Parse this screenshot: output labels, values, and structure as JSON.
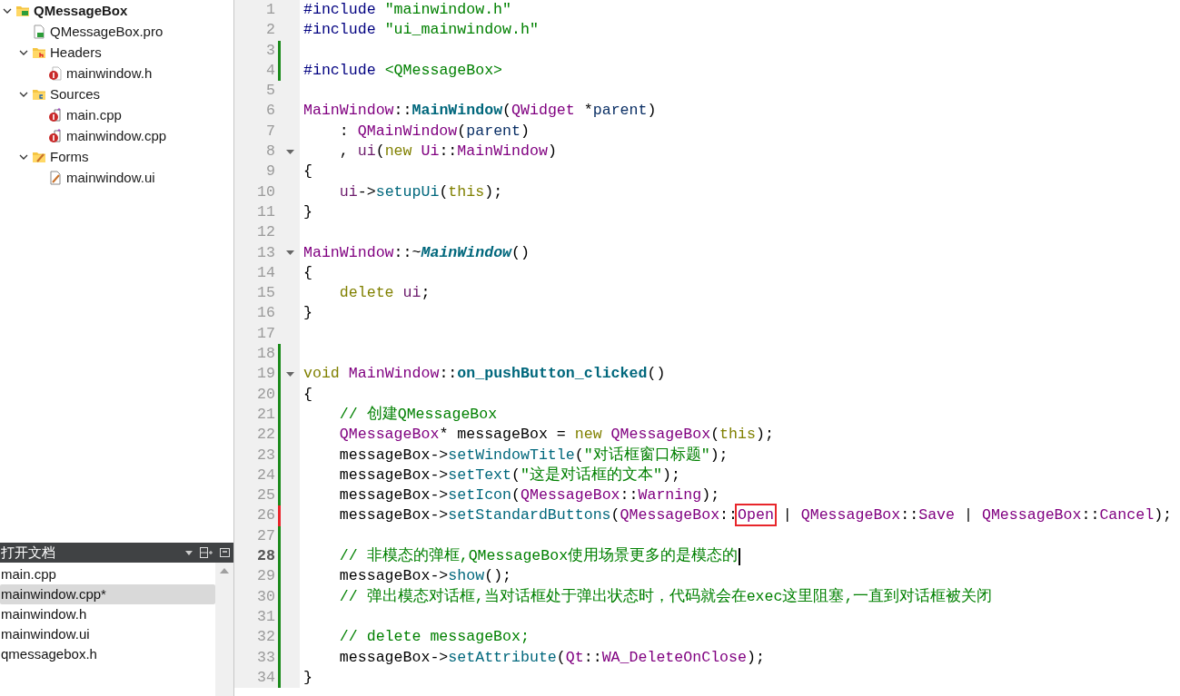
{
  "project_tree": [
    {
      "label": "QMessageBox",
      "kind": "project",
      "expanded": true,
      "children": [
        {
          "label": "QMessageBox.pro",
          "kind": "pro"
        },
        {
          "label": "Headers",
          "kind": "folder-h",
          "expanded": true,
          "children": [
            {
              "label": "mainwindow.h",
              "kind": "header"
            }
          ]
        },
        {
          "label": "Sources",
          "kind": "folder-cpp",
          "expanded": true,
          "children": [
            {
              "label": "main.cpp",
              "kind": "source"
            },
            {
              "label": "mainwindow.cpp",
              "kind": "source"
            }
          ]
        },
        {
          "label": "Forms",
          "kind": "folder-form",
          "expanded": true,
          "children": [
            {
              "label": "mainwindow.ui",
              "kind": "form"
            }
          ]
        }
      ]
    }
  ],
  "open_documents": {
    "title": "打开文档",
    "items": [
      {
        "label": "main.cpp",
        "selected": false
      },
      {
        "label": "mainwindow.cpp*",
        "selected": true
      },
      {
        "label": "mainwindow.h",
        "selected": false
      },
      {
        "label": "mainwindow.ui",
        "selected": false
      },
      {
        "label": "qmessagebox.h",
        "selected": false
      }
    ]
  },
  "editor": {
    "lines": [
      {
        "number": "1",
        "changed": false,
        "modified": false,
        "foldable": false,
        "current": false,
        "tokens": [
          {
            "text": "#include",
            "kind": "pp"
          },
          {
            "text": " \"mainwindow.h\"",
            "kind": "str"
          }
        ]
      },
      {
        "number": "2",
        "changed": false,
        "modified": false,
        "foldable": false,
        "current": false,
        "tokens": [
          {
            "text": "#include",
            "kind": "pp"
          },
          {
            "text": " \"ui_mainwindow.h\"",
            "kind": "str"
          }
        ]
      },
      {
        "number": "3",
        "changed": true,
        "modified": false,
        "foldable": false,
        "current": false
      },
      {
        "number": "4",
        "changed": true,
        "modified": false,
        "foldable": false,
        "current": false,
        "tokens": [
          {
            "text": "#include",
            "kind": "pp"
          },
          {
            "text": " <QMessageBox>",
            "kind": "str"
          }
        ]
      },
      {
        "number": "5",
        "changed": false,
        "modified": false,
        "foldable": false,
        "current": false
      },
      {
        "number": "6",
        "changed": false,
        "modified": false,
        "foldable": false,
        "current": false,
        "tokens": [
          {
            "text": "MainWindow",
            "kind": "type"
          },
          {
            "text": "::",
            "kind": "plain"
          },
          {
            "text": "MainWindow",
            "kind": "fndef"
          },
          {
            "text": "(",
            "kind": "plain"
          },
          {
            "text": "QWidget",
            "kind": "type"
          },
          {
            "text": " *",
            "kind": "plain"
          },
          {
            "text": "parent",
            "kind": "param"
          },
          {
            "text": ")",
            "kind": "plain"
          }
        ]
      },
      {
        "number": "7",
        "changed": false,
        "modified": false,
        "foldable": false,
        "current": false,
        "tokens": [
          {
            "text": "    : ",
            "kind": "plain"
          },
          {
            "text": "QMainWindow",
            "kind": "type"
          },
          {
            "text": "(",
            "kind": "plain"
          },
          {
            "text": "parent",
            "kind": "param"
          },
          {
            "text": ")",
            "kind": "plain"
          }
        ]
      },
      {
        "number": "8",
        "changed": false,
        "modified": false,
        "foldable": true,
        "current": false,
        "tokens": [
          {
            "text": "    , ",
            "kind": "plain"
          },
          {
            "text": "ui",
            "kind": "member"
          },
          {
            "text": "(",
            "kind": "plain"
          },
          {
            "text": "new",
            "kind": "kw"
          },
          {
            "text": " Ui",
            "kind": "type"
          },
          {
            "text": "::",
            "kind": "plain"
          },
          {
            "text": "MainWindow",
            "kind": "type"
          },
          {
            "text": ")",
            "kind": "plain"
          }
        ]
      },
      {
        "number": "9",
        "changed": false,
        "modified": false,
        "foldable": false,
        "current": false,
        "tokens": [
          {
            "text": "{",
            "kind": "plain"
          }
        ]
      },
      {
        "number": "10",
        "changed": false,
        "modified": false,
        "foldable": false,
        "current": false,
        "tokens": [
          {
            "text": "    ui",
            "kind": "member"
          },
          {
            "text": "->",
            "kind": "plain"
          },
          {
            "text": "setupUi",
            "kind": "fn"
          },
          {
            "text": "(",
            "kind": "plain"
          },
          {
            "text": "this",
            "kind": "kw"
          },
          {
            "text": ");",
            "kind": "plain"
          }
        ]
      },
      {
        "number": "11",
        "changed": false,
        "modified": false,
        "foldable": false,
        "current": false,
        "tokens": [
          {
            "text": "}",
            "kind": "plain"
          }
        ]
      },
      {
        "number": "12",
        "changed": false,
        "modified": false,
        "foldable": false,
        "current": false
      },
      {
        "number": "13",
        "changed": false,
        "modified": false,
        "foldable": true,
        "current": false,
        "tokens": [
          {
            "text": "MainWindow",
            "kind": "type"
          },
          {
            "text": "::~",
            "kind": "plain"
          },
          {
            "text": "MainWindow",
            "kind": "fndef_italic"
          },
          {
            "text": "()",
            "kind": "plain"
          }
        ]
      },
      {
        "number": "14",
        "changed": false,
        "modified": false,
        "foldable": false,
        "current": false,
        "tokens": [
          {
            "text": "{",
            "kind": "plain"
          }
        ]
      },
      {
        "number": "15",
        "changed": false,
        "modified": false,
        "foldable": false,
        "current": false,
        "tokens": [
          {
            "text": "    delete",
            "kind": "kw"
          },
          {
            "text": " ui",
            "kind": "member"
          },
          {
            "text": ";",
            "kind": "plain"
          }
        ]
      },
      {
        "number": "16",
        "changed": false,
        "modified": false,
        "foldable": false,
        "current": false,
        "tokens": [
          {
            "text": "}",
            "kind": "plain"
          }
        ]
      },
      {
        "number": "17",
        "changed": false,
        "modified": false,
        "foldable": false,
        "current": false
      },
      {
        "number": "18",
        "changed": true,
        "modified": false,
        "foldable": false,
        "current": false
      },
      {
        "number": "19",
        "changed": true,
        "modified": false,
        "foldable": true,
        "current": false,
        "tokens": [
          {
            "text": "void",
            "kind": "kw"
          },
          {
            "text": " MainWindow",
            "kind": "type"
          },
          {
            "text": "::",
            "kind": "plain"
          },
          {
            "text": "on_pushButton_clicked",
            "kind": "fndef"
          },
          {
            "text": "()",
            "kind": "plain"
          }
        ]
      },
      {
        "number": "20",
        "changed": true,
        "modified": false,
        "foldable": false,
        "current": false,
        "tokens": [
          {
            "text": "{",
            "kind": "plain"
          }
        ]
      },
      {
        "number": "21",
        "changed": true,
        "modified": false,
        "foldable": false,
        "current": false,
        "tokens": [
          {
            "text": "    // 创建QMessageBox",
            "kind": "cmt"
          }
        ]
      },
      {
        "number": "22",
        "changed": true,
        "modified": false,
        "foldable": false,
        "current": false,
        "tokens": [
          {
            "text": "    QMessageBox",
            "kind": "type"
          },
          {
            "text": "* messageBox = ",
            "kind": "plain"
          },
          {
            "text": "new",
            "kind": "kw"
          },
          {
            "text": " QMessageBox",
            "kind": "type"
          },
          {
            "text": "(",
            "kind": "plain"
          },
          {
            "text": "this",
            "kind": "kw"
          },
          {
            "text": ");",
            "kind": "plain"
          }
        ]
      },
      {
        "number": "23",
        "changed": true,
        "modified": false,
        "foldable": false,
        "current": false,
        "tokens": [
          {
            "text": "    messageBox->",
            "kind": "plain"
          },
          {
            "text": "setWindowTitle",
            "kind": "fn"
          },
          {
            "text": "(",
            "kind": "plain"
          },
          {
            "text": "\"对话框窗口标题\"",
            "kind": "str"
          },
          {
            "text": ");",
            "kind": "plain"
          }
        ]
      },
      {
        "number": "24",
        "changed": true,
        "modified": false,
        "foldable": false,
        "current": false,
        "tokens": [
          {
            "text": "    messageBox->",
            "kind": "plain"
          },
          {
            "text": "setText",
            "kind": "fn"
          },
          {
            "text": "(",
            "kind": "plain"
          },
          {
            "text": "\"这是对话框的文本\"",
            "kind": "str"
          },
          {
            "text": ");",
            "kind": "plain"
          }
        ]
      },
      {
        "number": "25",
        "changed": true,
        "modified": false,
        "foldable": false,
        "current": false,
        "tokens": [
          {
            "text": "    messageBox->",
            "kind": "plain"
          },
          {
            "text": "setIcon",
            "kind": "fn"
          },
          {
            "text": "(",
            "kind": "plain"
          },
          {
            "text": "QMessageBox",
            "kind": "type"
          },
          {
            "text": "::",
            "kind": "plain"
          },
          {
            "text": "Warning",
            "kind": "enum"
          },
          {
            "text": ");",
            "kind": "plain"
          }
        ]
      },
      {
        "number": "26",
        "changed": true,
        "modified": true,
        "foldable": false,
        "current": false,
        "tokens": [
          {
            "text": "    messageBox->",
            "kind": "plain"
          },
          {
            "text": "setStandardButtons",
            "kind": "fn"
          },
          {
            "text": "(",
            "kind": "plain"
          },
          {
            "text": "QMessageBox",
            "kind": "type"
          },
          {
            "text": "::",
            "kind": "plain"
          },
          {
            "text": "Open",
            "kind": "boxed"
          },
          {
            "text": " | ",
            "kind": "plain"
          },
          {
            "text": "QMessageBox",
            "kind": "type"
          },
          {
            "text": "::",
            "kind": "plain"
          },
          {
            "text": "Save",
            "kind": "enum"
          },
          {
            "text": " | ",
            "kind": "plain"
          },
          {
            "text": "QMessageBox",
            "kind": "type"
          },
          {
            "text": "::",
            "kind": "plain"
          },
          {
            "text": "Cancel",
            "kind": "enum"
          },
          {
            "text": ");",
            "kind": "plain"
          }
        ]
      },
      {
        "number": "27",
        "changed": true,
        "modified": false,
        "foldable": false,
        "current": false
      },
      {
        "number": "28",
        "changed": true,
        "modified": false,
        "foldable": false,
        "current": true,
        "tokens": [
          {
            "text": "    // 非模态的弹框,QMessageBox使用场景更多的是模态的",
            "kind": "cmt"
          }
        ]
      },
      {
        "number": "29",
        "changed": true,
        "modified": false,
        "foldable": false,
        "current": false,
        "tokens": [
          {
            "text": "    messageBox->",
            "kind": "plain"
          },
          {
            "text": "show",
            "kind": "fn"
          },
          {
            "text": "();",
            "kind": "plain"
          }
        ]
      },
      {
        "number": "30",
        "changed": true,
        "modified": false,
        "foldable": false,
        "current": false,
        "tokens": [
          {
            "text": "    // 弹出模态对话框,当对话框处于弹出状态时，代码就会在exec这里阻塞,一直到对话框被关闭",
            "kind": "cmt"
          }
        ]
      },
      {
        "number": "31",
        "changed": true,
        "modified": false,
        "foldable": false,
        "current": false
      },
      {
        "number": "32",
        "changed": true,
        "modified": false,
        "foldable": false,
        "current": false,
        "tokens": [
          {
            "text": "    // delete messageBox;",
            "kind": "cmt"
          }
        ]
      },
      {
        "number": "33",
        "changed": true,
        "modified": false,
        "foldable": false,
        "current": false,
        "tokens": [
          {
            "text": "    messageBox->",
            "kind": "plain"
          },
          {
            "text": "setAttribute",
            "kind": "fn"
          },
          {
            "text": "(",
            "kind": "plain"
          },
          {
            "text": "Qt",
            "kind": "type"
          },
          {
            "text": "::",
            "kind": "plain"
          },
          {
            "text": "WA_DeleteOnClose",
            "kind": "enum"
          },
          {
            "text": ");",
            "kind": "plain"
          }
        ]
      },
      {
        "number": "34",
        "changed": true,
        "modified": false,
        "foldable": false,
        "current": false,
        "tokens": [
          {
            "text": "}",
            "kind": "plain"
          }
        ]
      }
    ]
  }
}
